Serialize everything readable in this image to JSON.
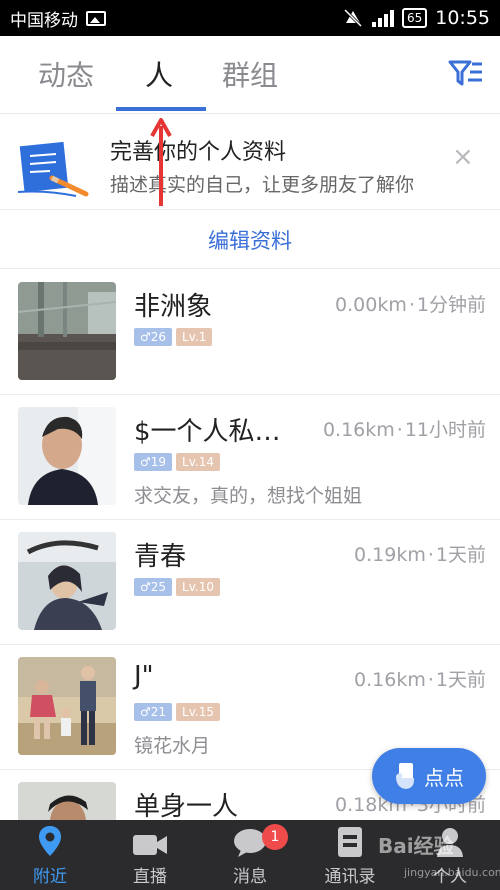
{
  "status_bar": {
    "carrier": "中国移动",
    "battery": "65",
    "time": "10:55"
  },
  "tabs": [
    {
      "label": "动态"
    },
    {
      "label": "人"
    },
    {
      "label": "群组"
    }
  ],
  "banner": {
    "title": "完善你的个人资料",
    "subtitle": "描述真实的自己，让更多朋友了解你",
    "close": "×",
    "edit_label": "编辑资料"
  },
  "people": [
    {
      "name": "非洲象",
      "distance": "0.00km",
      "time": "1分钟前",
      "gender_age": "♂26",
      "level": "Lv.1",
      "bio": ""
    },
    {
      "name": "$一个人私…",
      "distance": "0.16km",
      "time": "11小时前",
      "gender_age": "♂19",
      "level": "Lv.14",
      "bio": "求交友，真的，想找个姐姐"
    },
    {
      "name": "青春",
      "distance": "0.19km",
      "time": "1天前",
      "gender_age": "♂25",
      "level": "Lv.10",
      "bio": ""
    },
    {
      "name": "J\"",
      "distance": "0.16km",
      "time": "1天前",
      "gender_age": "♂21",
      "level": "Lv.15",
      "bio": "镜花水月"
    },
    {
      "name": "单身一人",
      "distance": "0.18km",
      "time": "3小时前",
      "gender_age": "",
      "level": "",
      "bio": ""
    }
  ],
  "fab": {
    "label": "点点"
  },
  "bottom_nav": [
    {
      "label": "附近",
      "icon": "location-pin-icon"
    },
    {
      "label": "直播",
      "icon": "video-camera-icon"
    },
    {
      "label": "消息",
      "icon": "chat-bubble-icon",
      "badge": "1"
    },
    {
      "label": "通讯录",
      "icon": "contacts-book-icon"
    },
    {
      "label": "个人",
      "icon": "person-icon"
    }
  ],
  "watermark": {
    "text": "Bai经验",
    "sub": "jingyan.baidu.com"
  },
  "colors": {
    "accent": "#3a6fd8",
    "nav_bg": "#2b2b2d",
    "badge_red": "#ef4b4b"
  }
}
